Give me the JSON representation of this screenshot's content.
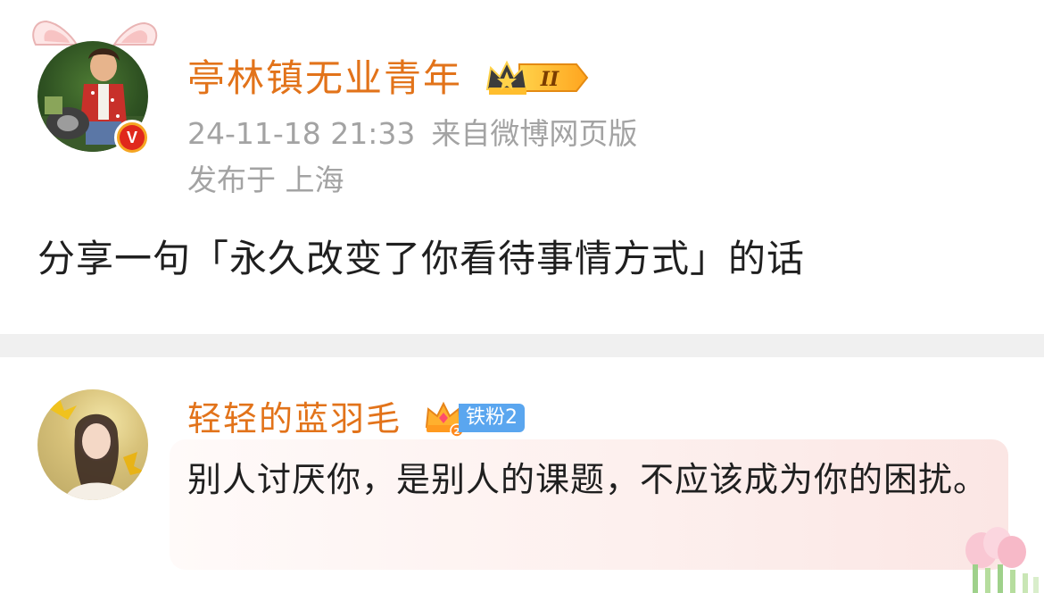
{
  "post": {
    "username": "亭林镇无业青年",
    "level_badge": "II",
    "timestamp": "24-11-18 21:33",
    "source": "来自微博网页版",
    "location": "发布于 上海",
    "text": "分享一句「永久改变了你看待事情方式」的话",
    "verified_mark": "V",
    "colors": {
      "username": "#e2731a",
      "meta": "#a3a3a3",
      "verified": "#e0281c"
    }
  },
  "comment": {
    "username": "轻轻的蓝羽毛",
    "fan_tag": "铁粉2",
    "fan_level": "2",
    "text": "别人讨厌你，是别人的课题，不应该成为你的困扰。",
    "colors": {
      "fan_tag_bg": "#5aa6ef",
      "bubble": "#fdf0ee"
    }
  },
  "icons": [
    "bunny-ears-icon",
    "verified-icon",
    "crown-level-icon",
    "fan-crown-icon",
    "flower-decoration-icon"
  ]
}
